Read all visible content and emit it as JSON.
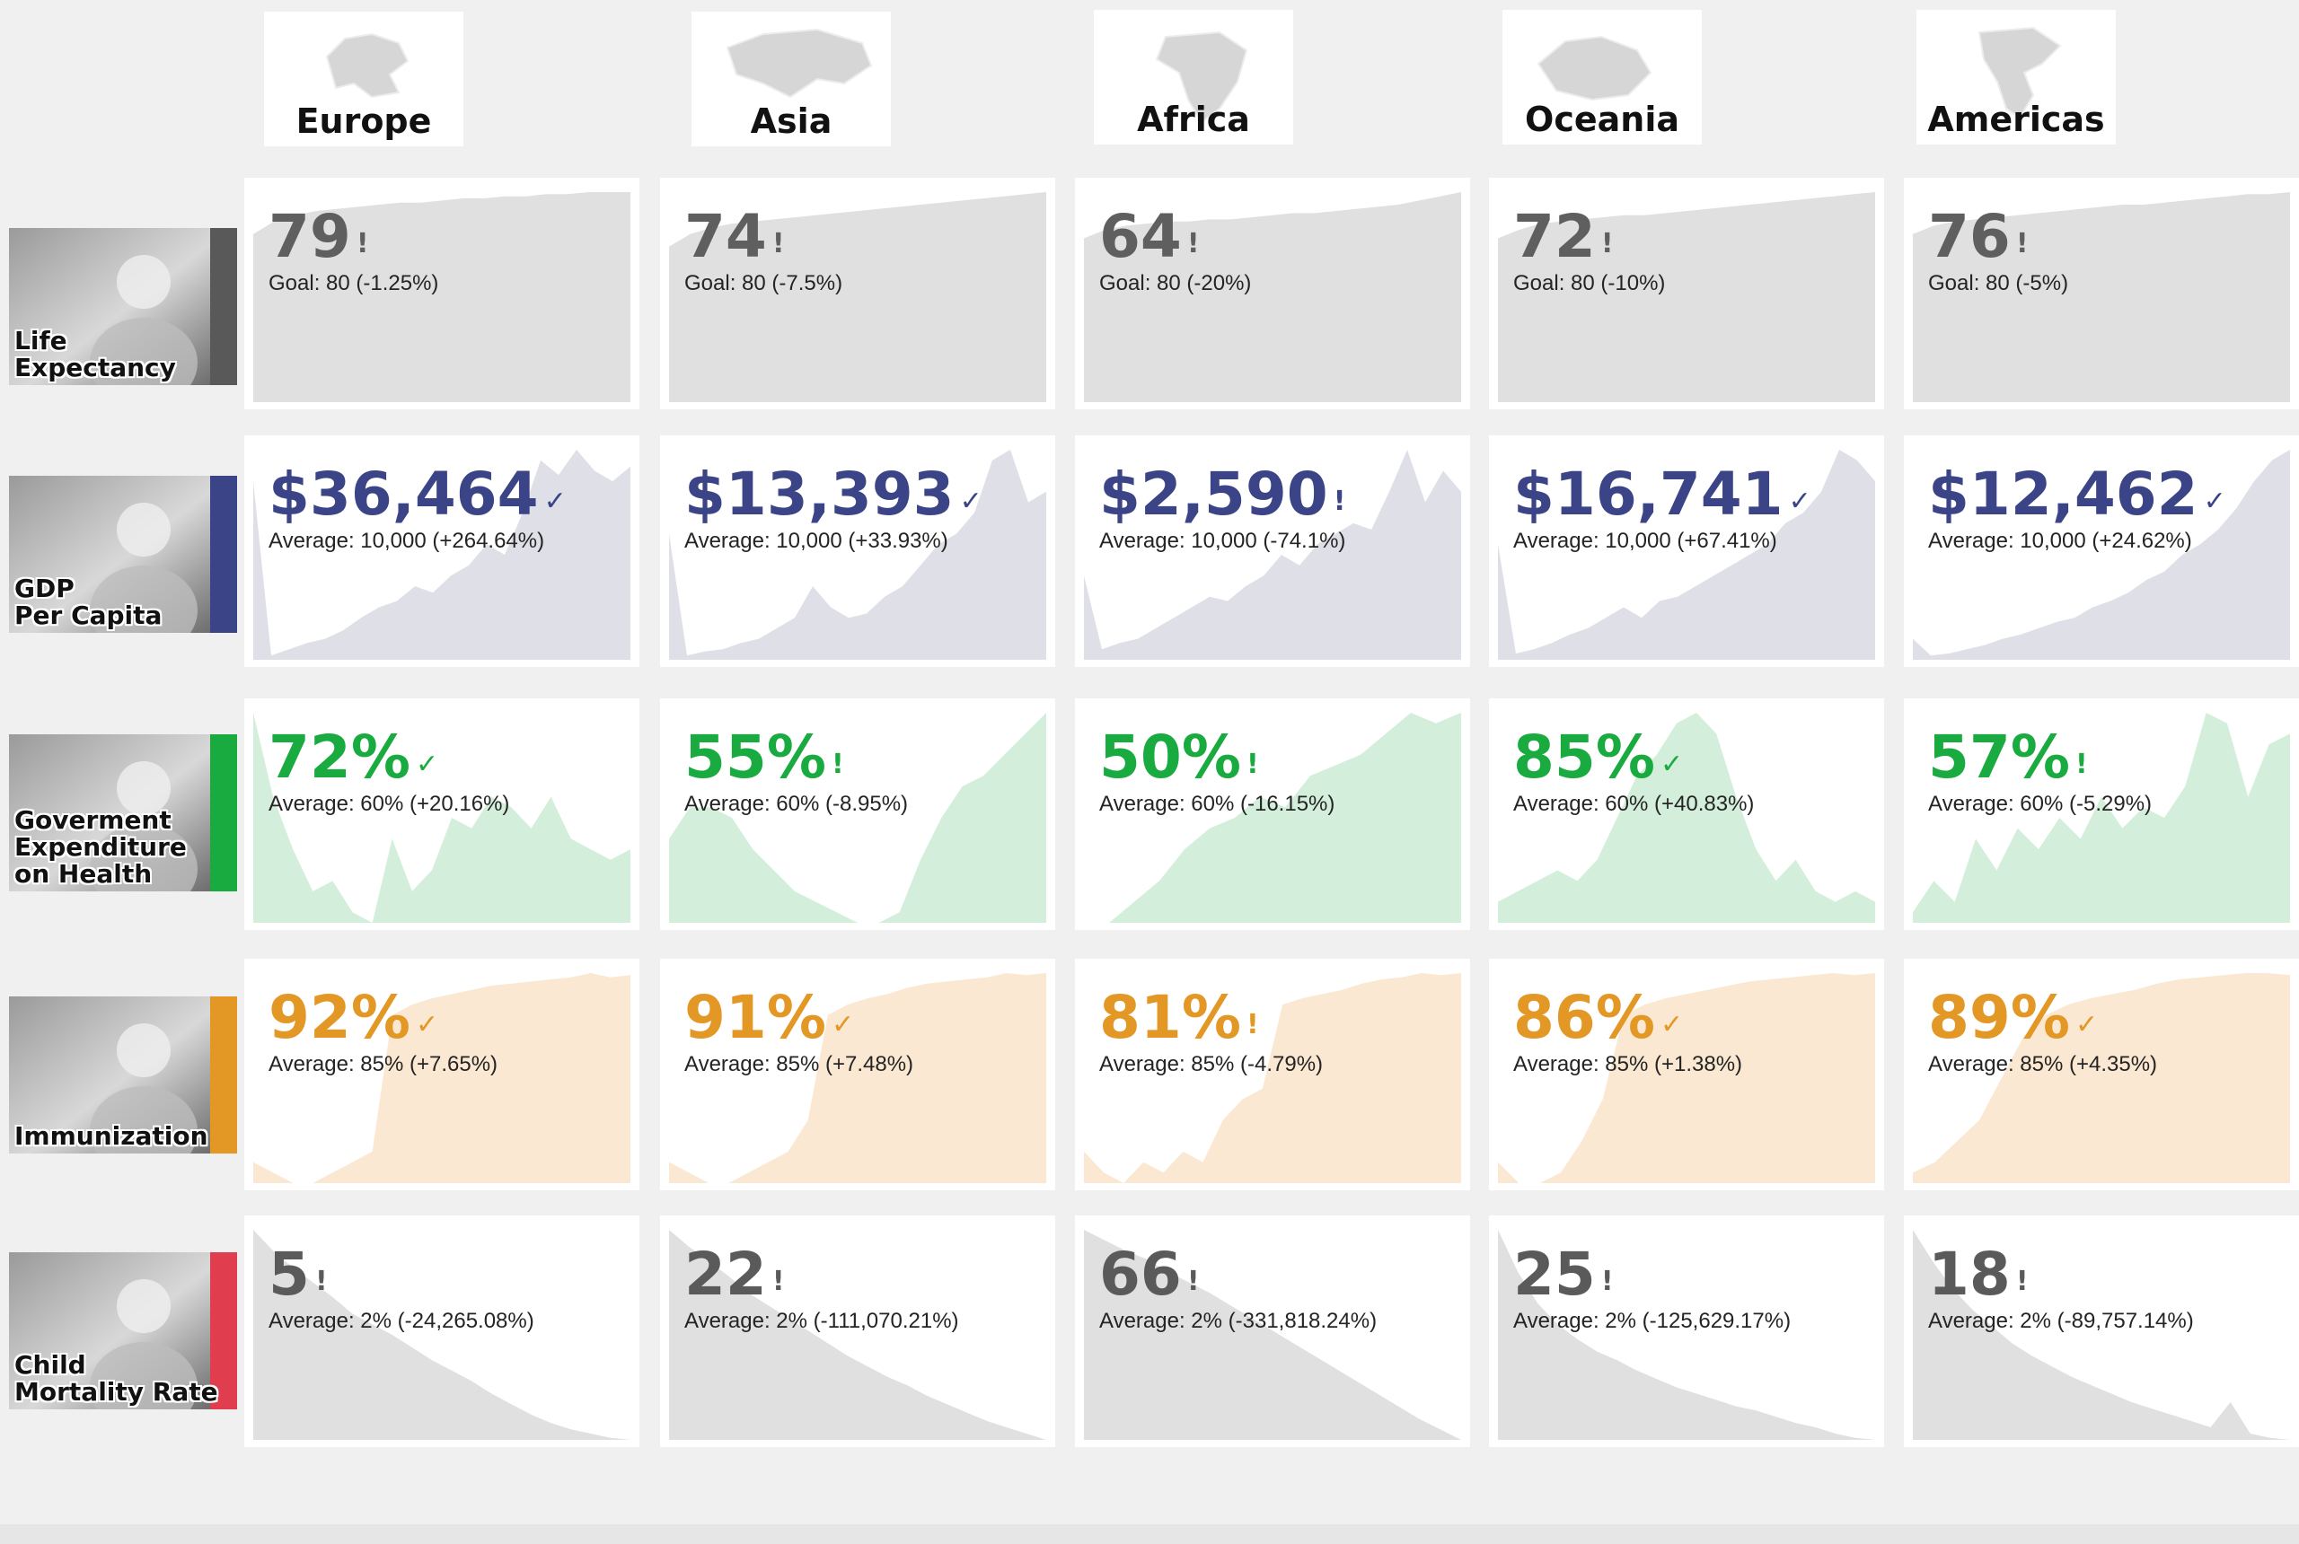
{
  "regions": [
    {
      "name": "Europe"
    },
    {
      "name": "Asia"
    },
    {
      "name": "Africa"
    },
    {
      "name": "Oceania"
    },
    {
      "name": "Americas"
    }
  ],
  "rows": [
    {
      "label_lines": [
        "Life",
        "Expectancy"
      ],
      "photo": "elderly-people-photo",
      "accent": "#595959",
      "value_color": "#5f5f5f",
      "fill": "#e0e0e0",
      "cards": [
        {
          "value": "79",
          "mark": "!",
          "sub": "Goal: 80 (-1.25%)",
          "trend": [
            0.8,
            0.86,
            0.89,
            0.91,
            0.92,
            0.93,
            0.94,
            0.95,
            0.95,
            0.96,
            0.97,
            0.97,
            0.98,
            0.98,
            0.99,
            0.99,
            1.0,
            1.0,
            1.0
          ]
        },
        {
          "value": "74",
          "mark": "!",
          "sub": "Goal: 80 (-7.5%)",
          "trend": [
            0.74,
            0.8,
            0.83,
            0.85,
            0.86,
            0.87,
            0.88,
            0.89,
            0.9,
            0.91,
            0.92,
            0.93,
            0.94,
            0.95,
            0.96,
            0.97,
            0.98,
            0.99,
            1.0
          ]
        },
        {
          "value": "64",
          "mark": "!",
          "sub": "Goal: 80 (-20%)",
          "trend": [
            0.78,
            0.82,
            0.84,
            0.85,
            0.86,
            0.86,
            0.87,
            0.87,
            0.88,
            0.89,
            0.9,
            0.9,
            0.91,
            0.92,
            0.93,
            0.94,
            0.96,
            0.98,
            1.0
          ]
        },
        {
          "value": "72",
          "mark": "!",
          "sub": "Goal: 80 (-10%)",
          "trend": [
            0.78,
            0.82,
            0.85,
            0.86,
            0.87,
            0.88,
            0.89,
            0.89,
            0.9,
            0.91,
            0.92,
            0.93,
            0.94,
            0.95,
            0.96,
            0.97,
            0.98,
            0.99,
            1.0
          ]
        },
        {
          "value": "76",
          "mark": "!",
          "sub": "Goal: 80 (-5%)",
          "trend": [
            0.8,
            0.84,
            0.86,
            0.87,
            0.88,
            0.89,
            0.9,
            0.91,
            0.92,
            0.93,
            0.94,
            0.94,
            0.95,
            0.96,
            0.97,
            0.98,
            0.99,
            0.99,
            1.0
          ]
        }
      ]
    },
    {
      "label_lines": [
        "GDP",
        "Per Capita"
      ],
      "photo": "man-at-laptop-photo",
      "accent": "#3b4486",
      "value_color": "#3b4486",
      "fill": "#dfdfe8",
      "cards": [
        {
          "value": "$36,464",
          "mark": "✓",
          "sub": "Average: 10,000 (+264.64%)",
          "trend": [
            0.85,
            0.02,
            0.05,
            0.08,
            0.1,
            0.14,
            0.2,
            0.25,
            0.28,
            0.35,
            0.32,
            0.4,
            0.45,
            0.55,
            0.5,
            0.7,
            0.95,
            0.88,
            1.0,
            0.9,
            0.85,
            0.92
          ]
        },
        {
          "value": "$13,393",
          "mark": "✓",
          "sub": "Average: 10,000 (+33.93%)",
          "trend": [
            0.6,
            0.02,
            0.04,
            0.05,
            0.08,
            0.1,
            0.15,
            0.2,
            0.35,
            0.25,
            0.2,
            0.22,
            0.3,
            0.35,
            0.45,
            0.55,
            0.6,
            0.7,
            0.95,
            1.0,
            0.75,
            0.8
          ]
        },
        {
          "value": "$2,590",
          "mark": "!",
          "sub": "Average: 10,000 (-74.1%)",
          "trend": [
            0.4,
            0.05,
            0.08,
            0.1,
            0.15,
            0.2,
            0.25,
            0.3,
            0.28,
            0.35,
            0.4,
            0.5,
            0.45,
            0.55,
            0.6,
            0.65,
            0.62,
            0.8,
            1.0,
            0.75,
            0.9,
            0.8
          ]
        },
        {
          "value": "$16,741",
          "mark": "✓",
          "sub": "Average: 10,000 (+67.41%)",
          "trend": [
            0.55,
            0.03,
            0.05,
            0.08,
            0.12,
            0.15,
            0.2,
            0.25,
            0.2,
            0.28,
            0.3,
            0.35,
            0.4,
            0.45,
            0.5,
            0.55,
            0.65,
            0.7,
            0.8,
            1.0,
            0.95,
            0.85
          ]
        },
        {
          "value": "$12,462",
          "mark": "✓",
          "sub": "Average: 10,000 (+24.62%)",
          "trend": [
            0.1,
            0.02,
            0.03,
            0.05,
            0.07,
            0.1,
            0.12,
            0.15,
            0.18,
            0.2,
            0.25,
            0.28,
            0.32,
            0.38,
            0.42,
            0.5,
            0.55,
            0.62,
            0.72,
            0.85,
            0.95,
            1.0
          ]
        }
      ]
    },
    {
      "label_lines": [
        "Goverment",
        "Expenditure",
        "on Health"
      ],
      "photo": "nurse-photo",
      "accent": "#1aab40",
      "value_color": "#1aab40",
      "fill": "#d3efdb",
      "cards": [
        {
          "value": "72%",
          "mark": "✓",
          "sub": "Average: 60% (+20.16%)",
          "trend": [
            1.0,
            0.6,
            0.35,
            0.15,
            0.2,
            0.05,
            0.0,
            0.4,
            0.15,
            0.25,
            0.5,
            0.45,
            0.6,
            0.55,
            0.45,
            0.6,
            0.4,
            0.35,
            0.3,
            0.35
          ]
        },
        {
          "value": "55%",
          "mark": "!",
          "sub": "Average: 60% (-8.95%)",
          "trend": [
            0.4,
            0.55,
            0.55,
            0.5,
            0.35,
            0.25,
            0.15,
            0.1,
            0.05,
            0.0,
            0.0,
            0.05,
            0.3,
            0.5,
            0.65,
            0.7,
            0.8,
            0.9,
            1.0
          ]
        },
        {
          "value": "50%",
          "mark": "!",
          "sub": "Average: 60% (-16.15%)",
          "trend": [
            0.0,
            0.0,
            0.1,
            0.2,
            0.35,
            0.45,
            0.5,
            0.6,
            0.55,
            0.7,
            0.75,
            0.8,
            0.9,
            1.0,
            0.95,
            1.0
          ]
        },
        {
          "value": "85%",
          "mark": "✓",
          "sub": "Average: 60% (+40.83%)",
          "trend": [
            0.1,
            0.15,
            0.2,
            0.25,
            0.2,
            0.3,
            0.5,
            0.7,
            0.8,
            0.95,
            1.0,
            0.9,
            0.6,
            0.35,
            0.2,
            0.3,
            0.15,
            0.1,
            0.15,
            0.1
          ]
        },
        {
          "value": "57%",
          "mark": "!",
          "sub": "Average: 60% (-5.29%)",
          "trend": [
            0.05,
            0.2,
            0.1,
            0.4,
            0.25,
            0.45,
            0.35,
            0.5,
            0.4,
            0.6,
            0.45,
            0.55,
            0.5,
            0.65,
            1.0,
            0.95,
            0.6,
            0.85,
            0.9
          ]
        }
      ]
    },
    {
      "label_lines": [
        "Immunization"
      ],
      "photo": "vaccination-photo",
      "accent": "#e39725",
      "value_color": "#e39725",
      "fill": "#fbe8d3",
      "cards": [
        {
          "value": "92%",
          "mark": "✓",
          "sub": "Average: 85% (+7.65%)",
          "trend": [
            0.1,
            0.05,
            0.0,
            0.0,
            0.05,
            0.1,
            0.15,
            0.8,
            0.85,
            0.88,
            0.9,
            0.92,
            0.94,
            0.95,
            0.96,
            0.97,
            0.98,
            1.0,
            0.98,
            0.99
          ]
        },
        {
          "value": "91%",
          "mark": "✓",
          "sub": "Average: 85% (+7.48%)",
          "trend": [
            0.1,
            0.05,
            0.0,
            0.0,
            0.05,
            0.1,
            0.15,
            0.3,
            0.8,
            0.85,
            0.88,
            0.9,
            0.93,
            0.95,
            0.96,
            0.97,
            0.98,
            1.0,
            0.99,
            1.0
          ]
        },
        {
          "value": "81%",
          "mark": "!",
          "sub": "Average: 85% (-4.79%)",
          "trend": [
            0.15,
            0.05,
            0.0,
            0.1,
            0.05,
            0.15,
            0.1,
            0.3,
            0.4,
            0.45,
            0.85,
            0.88,
            0.9,
            0.92,
            0.95,
            0.97,
            0.98,
            1.0,
            0.99,
            1.0
          ]
        },
        {
          "value": "86%",
          "mark": "✓",
          "sub": "Average: 85% (+1.38%)",
          "trend": [
            0.1,
            0.0,
            0.0,
            0.05,
            0.2,
            0.4,
            0.8,
            0.85,
            0.88,
            0.9,
            0.92,
            0.94,
            0.96,
            0.97,
            0.98,
            0.99,
            1.0,
            0.99,
            1.0
          ]
        },
        {
          "value": "89%",
          "mark": "✓",
          "sub": "Average: 85% (+4.35%)",
          "trend": [
            0.05,
            0.1,
            0.2,
            0.3,
            0.5,
            0.7,
            0.8,
            0.85,
            0.88,
            0.9,
            0.92,
            0.95,
            0.97,
            0.98,
            0.99,
            1.0,
            1.0,
            0.99
          ]
        }
      ]
    },
    {
      "label_lines": [
        "Child",
        "Mortality Rate"
      ],
      "photo": "baby-photo",
      "accent": "#e03e4e",
      "value_color": "#5a5a5a",
      "fill": "#e0e0e0",
      "cards": [
        {
          "value": "5",
          "mark": "!",
          "sub": "Average: 2% (-24,265.08%)",
          "trend": [
            1.0,
            0.9,
            0.82,
            0.75,
            0.68,
            0.6,
            0.55,
            0.5,
            0.44,
            0.38,
            0.33,
            0.28,
            0.22,
            0.17,
            0.12,
            0.08,
            0.05,
            0.03,
            0.01,
            0.0
          ]
        },
        {
          "value": "22",
          "mark": "!",
          "sub": "Average: 2% (-111,070.21%)",
          "trend": [
            1.0,
            0.92,
            0.85,
            0.78,
            0.7,
            0.64,
            0.58,
            0.52,
            0.46,
            0.4,
            0.35,
            0.3,
            0.26,
            0.21,
            0.17,
            0.13,
            0.09,
            0.06,
            0.03,
            0.0
          ]
        },
        {
          "value": "66",
          "mark": "!",
          "sub": "Average: 2% (-331,818.24%)",
          "trend": [
            1.0,
            0.95,
            0.9,
            0.86,
            0.8,
            0.75,
            0.7,
            0.64,
            0.58,
            0.52,
            0.46,
            0.4,
            0.34,
            0.28,
            0.22,
            0.16,
            0.1,
            0.05,
            0.0
          ]
        },
        {
          "value": "25",
          "mark": "!",
          "sub": "Average: 2% (-125,629.17%)",
          "trend": [
            1.0,
            0.8,
            0.65,
            0.55,
            0.48,
            0.42,
            0.38,
            0.33,
            0.29,
            0.25,
            0.22,
            0.19,
            0.16,
            0.14,
            0.11,
            0.08,
            0.06,
            0.03,
            0.01,
            0.0
          ]
        },
        {
          "value": "18",
          "mark": "!",
          "sub": "Average: 2% (-89,757.14%)",
          "trend": [
            1.0,
            0.85,
            0.72,
            0.62,
            0.54,
            0.46,
            0.4,
            0.35,
            0.3,
            0.26,
            0.22,
            0.18,
            0.15,
            0.12,
            0.09,
            0.06,
            0.18,
            0.03,
            0.01,
            0.0
          ]
        }
      ]
    }
  ]
}
